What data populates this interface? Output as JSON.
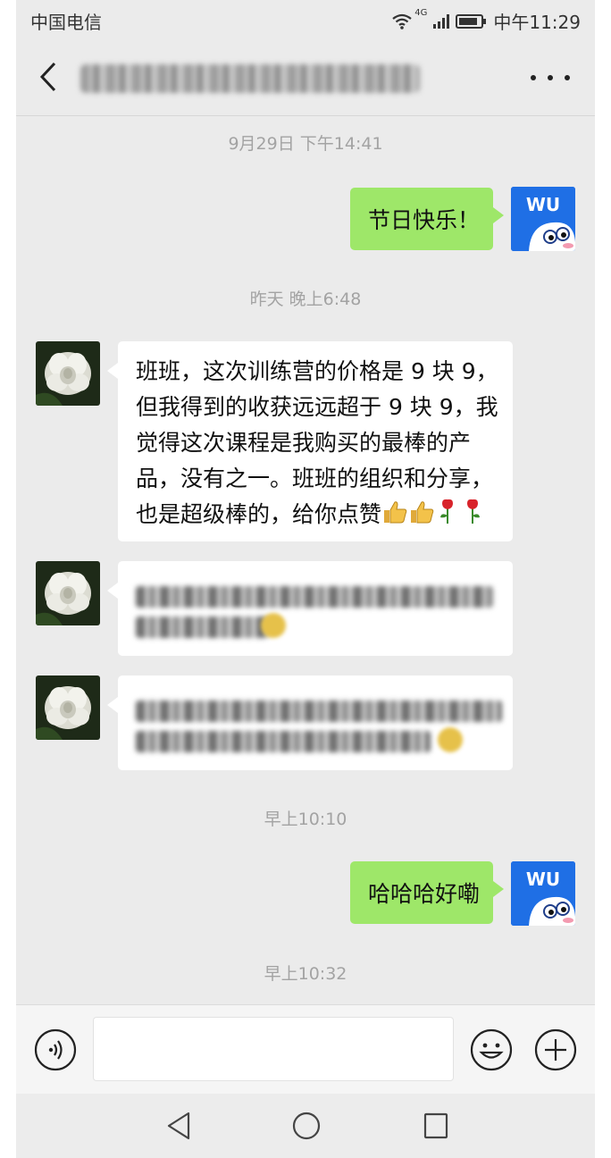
{
  "status_bar": {
    "carrier": "中国电信",
    "network": "4G",
    "time": "中午11:29",
    "icons": [
      "wifi-icon",
      "signal-icon",
      "battery-icon"
    ]
  },
  "header": {
    "title": "",
    "back_icon": "back-arrow-icon",
    "more_icon": "more-icon"
  },
  "messages": [
    {
      "type": "timestamp",
      "text": "9月29日 下午14:41"
    },
    {
      "type": "outgoing",
      "text": "节日快乐！",
      "avatar_text": "WU"
    },
    {
      "type": "timestamp",
      "text": "昨天 晚上6:48"
    },
    {
      "type": "incoming",
      "lines": [
        "班班，这次训练营的价格是 9 块 9，",
        "但我得到的收获远远超于 9 块 9，我",
        "觉得这次课程是我购买的最棒的产",
        "品，没有之一。班班的组织和分享，",
        "也是超级棒的，给你点赞"
      ],
      "emoji_trail": [
        "thumbs-up-icon",
        "thumbs-up-icon",
        "rose-icon",
        "rose-icon"
      ]
    },
    {
      "type": "incoming_blurred",
      "lines": [
        "",
        ""
      ]
    },
    {
      "type": "incoming_blurred",
      "lines": [
        "",
        ""
      ]
    },
    {
      "type": "timestamp",
      "text": "早上10:10"
    },
    {
      "type": "outgoing",
      "text": "哈哈哈好嘞",
      "avatar_text": "WU"
    },
    {
      "type": "timestamp",
      "text": "早上10:32"
    }
  ],
  "input_bar": {
    "placeholder": "",
    "icons": [
      "voice-icon",
      "emoji-icon",
      "plus-icon"
    ]
  },
  "system_nav": {
    "icons": [
      "nav-back-icon",
      "nav-home-icon",
      "nav-recent-icon"
    ]
  },
  "colors": {
    "background": "#ebebeb",
    "outgoing_bubble": "#9ee769",
    "incoming_bubble": "#ffffff",
    "avatar_blue": "#1f6fe5",
    "timestamp_text": "#a3a3a3"
  }
}
